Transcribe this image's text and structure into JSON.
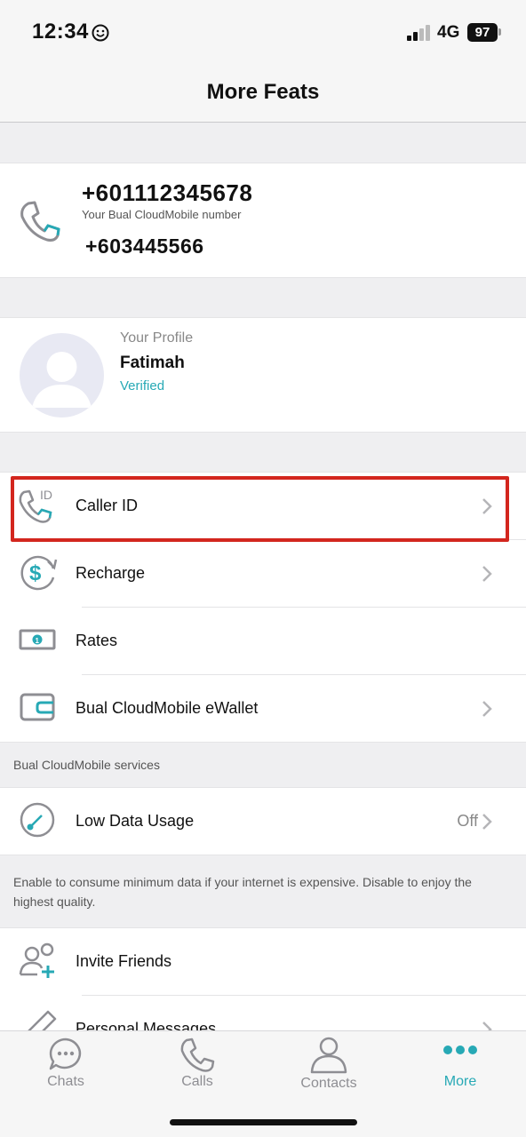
{
  "status_bar": {
    "time": "12:34",
    "network": "4G",
    "battery": "97"
  },
  "header": {
    "title": "More Feats"
  },
  "numbers": {
    "primary": "+601112345678",
    "caption": "Your Bual CloudMobile number",
    "secondary": "+603445566"
  },
  "profile": {
    "label": "Your Profile",
    "name": "Fatimah",
    "status": "Verified"
  },
  "menu": {
    "items": [
      {
        "label": "Caller ID",
        "icon": "phone-id-icon",
        "chevron": true,
        "highlighted": true
      },
      {
        "label": "Recharge",
        "icon": "dollar-refresh-icon",
        "chevron": true
      },
      {
        "label": "Rates",
        "icon": "banknote-icon",
        "chevron": false
      },
      {
        "label": "Bual CloudMobile eWallet",
        "icon": "wallet-icon",
        "chevron": true
      }
    ]
  },
  "services": {
    "caption": "Bual CloudMobile services",
    "low_data": {
      "label": "Low Data Usage",
      "value": "Off",
      "icon": "speed-gauge-icon"
    },
    "help_text": "Enable to consume minimum data if your internet is expensive. Disable to enjoy the highest quality."
  },
  "more_items": [
    {
      "label": "Invite Friends",
      "icon": "add-friend-icon"
    },
    {
      "label": "Personal Messages",
      "icon": "pencil-icon"
    }
  ],
  "tabs": [
    {
      "label": "Chats",
      "icon": "chat-bubble-icon",
      "active": false
    },
    {
      "label": "Calls",
      "icon": "phone-icon",
      "active": false
    },
    {
      "label": "Contacts",
      "icon": "person-icon",
      "active": false
    },
    {
      "label": "More",
      "icon": "more-dots-icon",
      "active": true
    }
  ],
  "colors": {
    "accent": "#27a9b5",
    "highlight": "#d3261e",
    "icon_gray": "#8e8e93"
  }
}
